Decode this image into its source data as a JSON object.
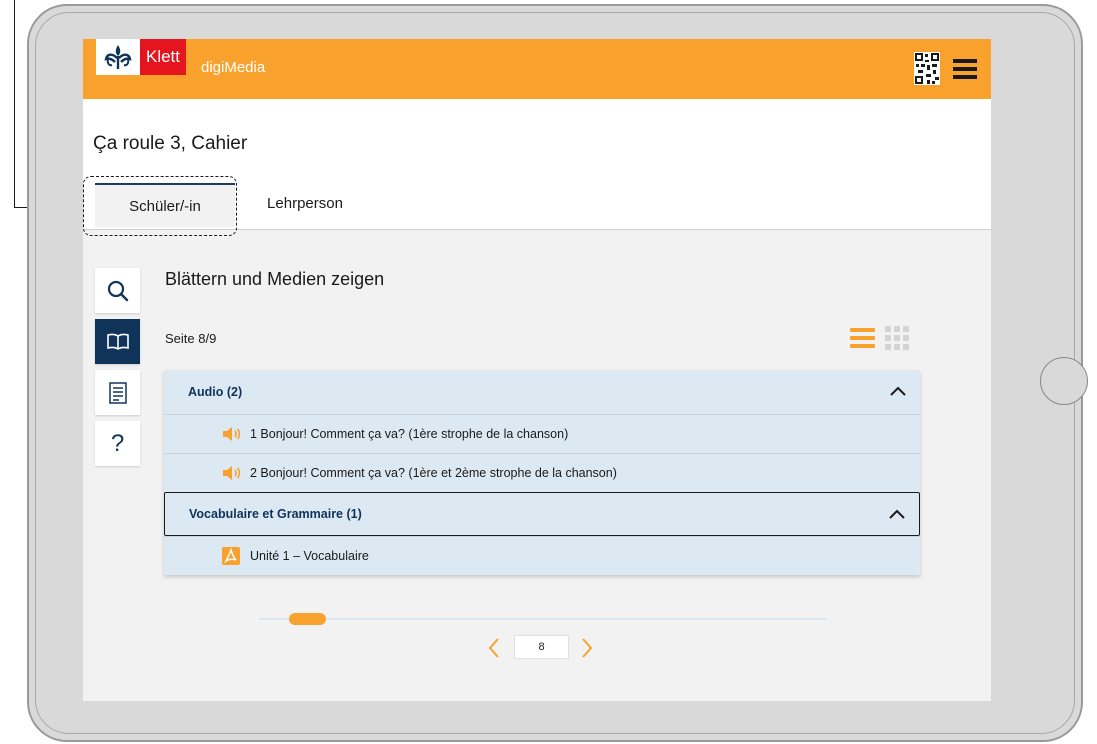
{
  "brand": {
    "logo_text": "Klett",
    "app_name": "digiMedia"
  },
  "book": {
    "title": "Ça roule 3, Cahier"
  },
  "tabs": [
    {
      "label": "Schüler/-in",
      "active": true
    },
    {
      "label": "Lehrperson",
      "active": false
    }
  ],
  "tools": [
    "search-icon",
    "book-icon",
    "toc-icon",
    "help-icon"
  ],
  "help_glyph": "?",
  "main": {
    "section_title": "Blättern und Medien zeigen",
    "page_info": "Seite 8/9",
    "view_mode": "list"
  },
  "groups": [
    {
      "title": "Audio (2)",
      "expanded": true,
      "items": [
        {
          "icon": "speaker-icon",
          "label": "1 Bonjour! Comment ça va? (1ère strophe de la chanson)"
        },
        {
          "icon": "speaker-icon",
          "label": "2 Bonjour! Comment ça va? (1ère et 2ème strophe de la chanson)"
        }
      ]
    },
    {
      "title": "Vocabulaire et Grammaire (1)",
      "expanded": true,
      "items": [
        {
          "icon": "pdf-icon",
          "label": "Unité 1 – Vocabulaire"
        }
      ]
    }
  ],
  "pager": {
    "current_page": "8"
  },
  "colors": {
    "accent": "#f9a12d",
    "brand_red": "#e4151f",
    "navy": "#10335a",
    "panel_bg": "#dce9f3"
  }
}
